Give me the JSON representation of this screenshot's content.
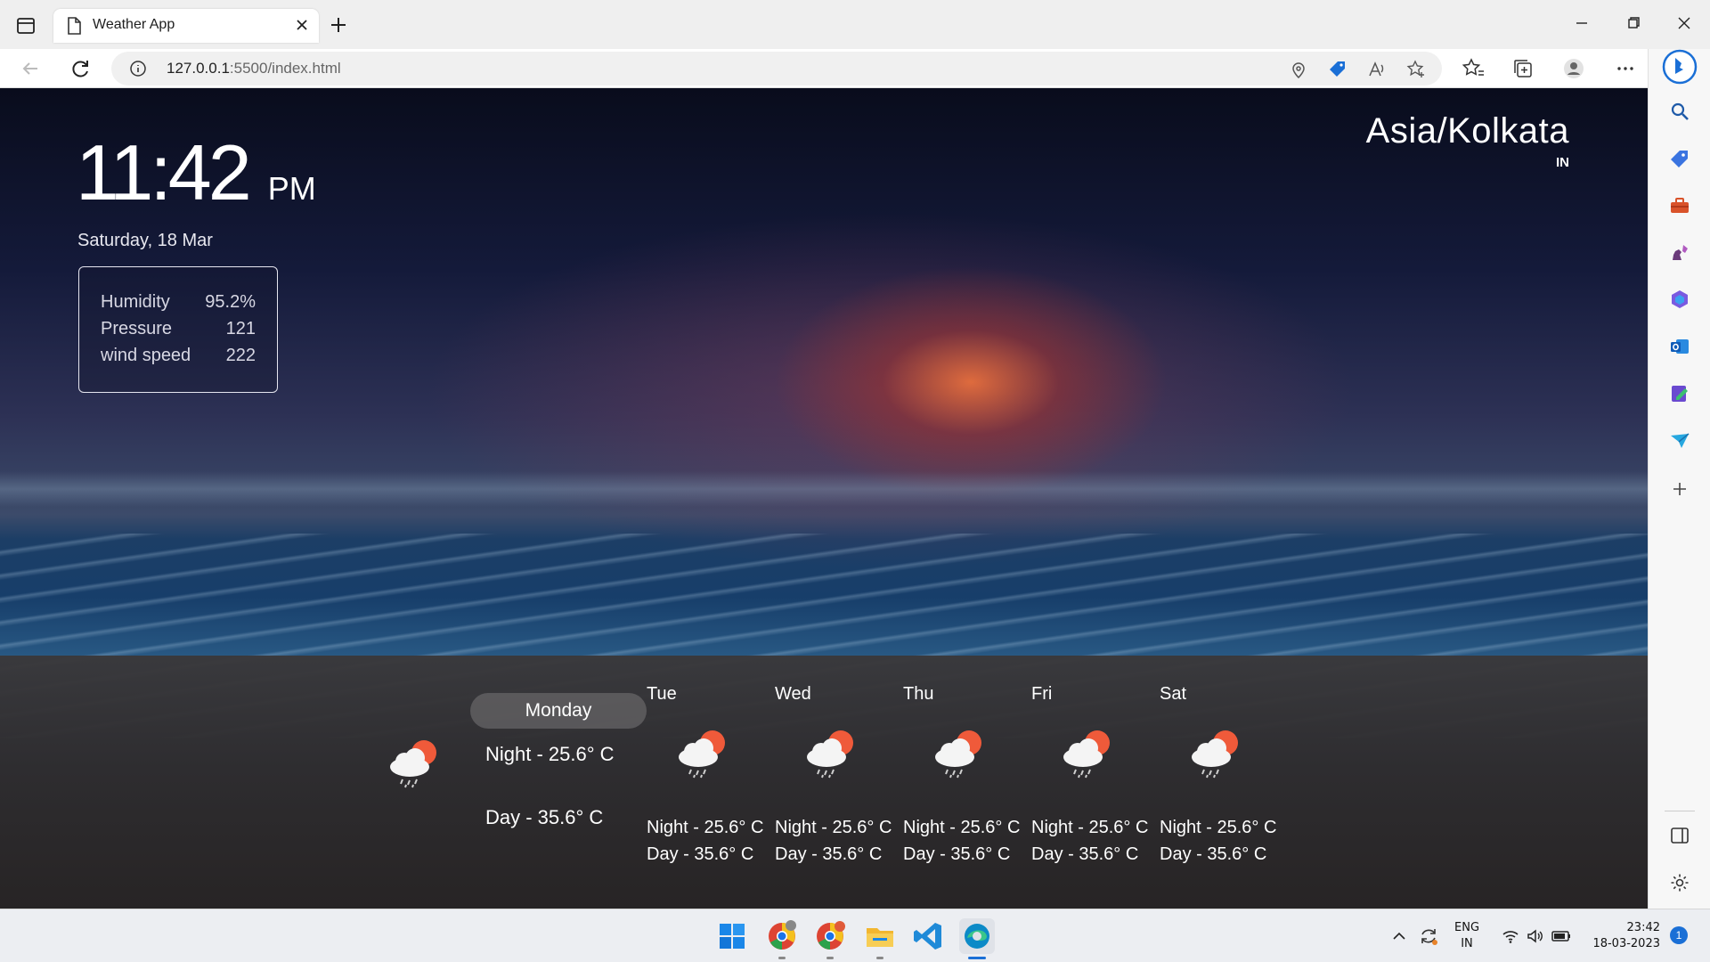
{
  "browser": {
    "tab_title": "Weather App",
    "url_host": "127.0.0.1",
    "url_path": ":5500/index.html"
  },
  "weather": {
    "time": "11:42",
    "ampm": "PM",
    "date": "Saturday, 18 Mar",
    "stats": [
      {
        "label": "Humidity",
        "value": "95.2%"
      },
      {
        "label": "Pressure",
        "value": "121"
      },
      {
        "label": "wind speed",
        "value": "222"
      }
    ],
    "timezone": "Asia/Kolkata",
    "country": "IN",
    "today": {
      "day": "Monday",
      "night": "Night - 25.6° C",
      "day_temp": "Day - 35.6° C"
    },
    "forecast": [
      {
        "day": "Tue",
        "night": "Night - 25.6° C",
        "day_temp": "Day - 35.6° C"
      },
      {
        "day": "Wed",
        "night": "Night - 25.6° C",
        "day_temp": "Day - 35.6° C"
      },
      {
        "day": "Thu",
        "night": "Night - 25.6° C",
        "day_temp": "Day - 35.6° C"
      },
      {
        "day": "Fri",
        "night": "Night - 25.6° C",
        "day_temp": "Day - 35.6° C"
      },
      {
        "day": "Sat",
        "night": "Night - 25.6° C",
        "day_temp": "Day - 35.6° C"
      }
    ]
  },
  "taskbar": {
    "lang_top": "ENG",
    "lang_bottom": "IN",
    "time": "23:42",
    "date": "18-03-2023",
    "notif_count": "1"
  },
  "icons": {
    "weather": "cloud-sun-rain-icon"
  }
}
